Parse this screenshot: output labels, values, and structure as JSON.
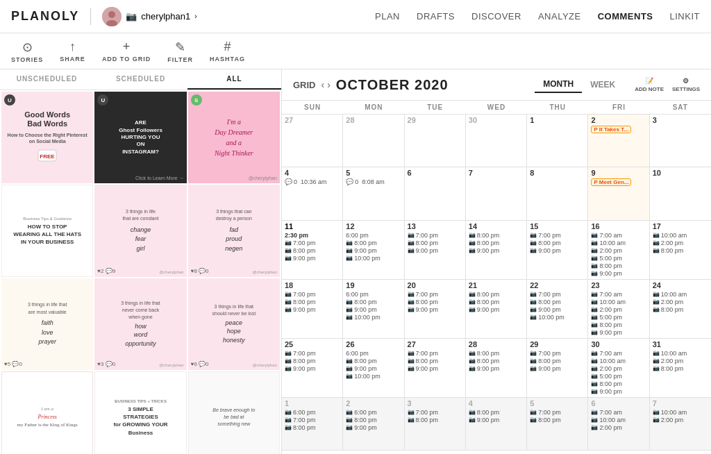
{
  "header": {
    "logo": "PLANOLY",
    "username": "cherylphan1",
    "nav": [
      {
        "label": "PLAN",
        "active": false
      },
      {
        "label": "DRAFTS",
        "active": false
      },
      {
        "label": "DISCOVER",
        "active": false
      },
      {
        "label": "ANALYZE",
        "active": false
      },
      {
        "label": "COMMENTS",
        "active": true
      },
      {
        "label": "LINKIT",
        "active": false
      }
    ]
  },
  "toolbar": [
    {
      "label": "STORIES",
      "icon": "⊙"
    },
    {
      "label": "SHARE",
      "icon": "↑"
    },
    {
      "label": "ADD TO GRID",
      "icon": "+"
    },
    {
      "label": "FILTER",
      "icon": "✎"
    },
    {
      "label": "HASHTAG",
      "icon": "#"
    }
  ],
  "left_panel": {
    "tabs": [
      "UNSCHEDULED",
      "SCHEDULED",
      "ALL"
    ],
    "active_tab": 2
  },
  "calendar": {
    "grid_label": "GRID",
    "month": "OCTOBER 2020",
    "views": [
      "MONTH",
      "WEEK"
    ],
    "active_view": "MONTH",
    "actions": [
      "ADD NOTE",
      "SETTINGS"
    ],
    "day_headers": [
      "SUN",
      "MON",
      "TUE",
      "WED",
      "THU",
      "FRI",
      "SAT"
    ],
    "weeks": [
      {
        "days": [
          {
            "date": "27",
            "current": false,
            "events": []
          },
          {
            "date": "28",
            "current": false,
            "events": []
          },
          {
            "date": "29",
            "current": false,
            "events": []
          },
          {
            "date": "30",
            "current": false,
            "events": []
          },
          {
            "date": "1",
            "current": true,
            "events": []
          },
          {
            "date": "2",
            "current": true,
            "events": [
              {
                "type": "planned",
                "text": "It Takes T..."
              }
            ]
          },
          {
            "date": "3",
            "current": true,
            "events": []
          }
        ]
      },
      {
        "days": [
          {
            "date": "4",
            "current": true,
            "events": [
              {
                "type": "comment",
                "count": "0",
                "time": "10:36 am"
              }
            ]
          },
          {
            "date": "5",
            "current": true,
            "events": [
              {
                "type": "comment",
                "count": "0",
                "time": "8:08 am"
              }
            ]
          },
          {
            "date": "6",
            "current": true,
            "events": []
          },
          {
            "date": "7",
            "current": true,
            "events": []
          },
          {
            "date": "8",
            "current": true,
            "events": []
          },
          {
            "date": "9",
            "current": true,
            "events": [
              {
                "type": "planned",
                "text": "Meet Gen..."
              }
            ]
          },
          {
            "date": "10",
            "current": true,
            "events": []
          }
        ]
      },
      {
        "days": [
          {
            "date": "11",
            "current": true,
            "events": [
              {
                "type": "time",
                "text": "2:30 pm"
              },
              {
                "type": "ig",
                "text": "7:00 pm"
              },
              {
                "type": "ig",
                "text": "8:00 pm"
              },
              {
                "type": "ig",
                "text": "9:00 pm"
              }
            ]
          },
          {
            "date": "12",
            "current": true,
            "events": [
              {
                "type": "time",
                "text": "6:00 pm"
              },
              {
                "type": "ig",
                "text": "8:00 pm"
              },
              {
                "type": "ig",
                "text": "9:00 pm"
              },
              {
                "type": "ig",
                "text": "10:00 pm"
              }
            ]
          },
          {
            "date": "13",
            "current": true,
            "events": [
              {
                "type": "ig",
                "text": "7:00 pm"
              },
              {
                "type": "ig",
                "text": "8:00 pm"
              },
              {
                "type": "ig",
                "text": "9:00 pm"
              }
            ]
          },
          {
            "date": "14",
            "current": true,
            "events": [
              {
                "type": "ig",
                "text": "8:00 pm"
              },
              {
                "type": "ig",
                "text": "8:00 pm"
              },
              {
                "type": "ig",
                "text": "9:00 pm"
              }
            ]
          },
          {
            "date": "15",
            "current": true,
            "events": [
              {
                "type": "ig",
                "text": "7:00 pm"
              },
              {
                "type": "ig",
                "text": "8:00 pm"
              },
              {
                "type": "ig",
                "text": "9:00 pm"
              }
            ]
          },
          {
            "date": "16",
            "current": true,
            "events": [
              {
                "type": "ig",
                "text": "7:00 am"
              },
              {
                "type": "ig",
                "text": "10:00 am"
              },
              {
                "type": "ig",
                "text": "2:00 pm"
              },
              {
                "type": "ig",
                "text": "5:00 pm"
              },
              {
                "type": "ig",
                "text": "8:00 pm"
              },
              {
                "type": "ig",
                "text": "9:00 pm"
              }
            ]
          },
          {
            "date": "17",
            "current": true,
            "events": [
              {
                "type": "ig",
                "text": "10:00 am"
              },
              {
                "type": "ig",
                "text": "2:00 pm"
              },
              {
                "type": "ig",
                "text": "8:00 pm"
              }
            ]
          }
        ]
      },
      {
        "days": [
          {
            "date": "18",
            "current": true,
            "events": [
              {
                "type": "ig",
                "text": "7:00 pm"
              },
              {
                "type": "ig",
                "text": "8:00 pm"
              },
              {
                "type": "ig",
                "text": "9:00 pm"
              }
            ]
          },
          {
            "date": "19",
            "current": true,
            "events": [
              {
                "type": "ig",
                "text": "6:00 pm"
              },
              {
                "type": "ig",
                "text": "8:00 pm"
              },
              {
                "type": "ig",
                "text": "9:00 pm"
              },
              {
                "type": "ig",
                "text": "10:00 pm"
              }
            ]
          },
          {
            "date": "20",
            "current": true,
            "events": [
              {
                "type": "ig",
                "text": "7:00 pm"
              },
              {
                "type": "ig",
                "text": "8:00 pm"
              },
              {
                "type": "ig",
                "text": "9:00 pm"
              }
            ]
          },
          {
            "date": "21",
            "current": true,
            "events": [
              {
                "type": "ig",
                "text": "8:00 pm"
              },
              {
                "type": "ig",
                "text": "8:00 pm"
              },
              {
                "type": "ig",
                "text": "9:00 pm"
              }
            ]
          },
          {
            "date": "22",
            "current": true,
            "events": [
              {
                "type": "ig",
                "text": "7:00 pm"
              },
              {
                "type": "ig",
                "text": "8:00 pm"
              },
              {
                "type": "ig",
                "text": "9:00 pm"
              },
              {
                "type": "ig",
                "text": "10:00 pm"
              }
            ]
          },
          {
            "date": "23",
            "current": true,
            "events": [
              {
                "type": "ig",
                "text": "7:00 am"
              },
              {
                "type": "ig",
                "text": "10:00 am"
              },
              {
                "type": "ig",
                "text": "2:00 pm"
              },
              {
                "type": "ig",
                "text": "5:00 pm"
              },
              {
                "type": "ig",
                "text": "8:00 pm"
              },
              {
                "type": "ig",
                "text": "9:00 pm"
              }
            ]
          },
          {
            "date": "24",
            "current": true,
            "events": [
              {
                "type": "ig",
                "text": "10:00 am"
              },
              {
                "type": "ig",
                "text": "2:00 pm"
              },
              {
                "type": "ig",
                "text": "8:00 pm"
              }
            ]
          }
        ]
      },
      {
        "days": [
          {
            "date": "25",
            "current": true,
            "events": [
              {
                "type": "ig",
                "text": "7:00 pm"
              },
              {
                "type": "ig",
                "text": "8:00 pm"
              },
              {
                "type": "ig",
                "text": "9:00 pm"
              }
            ]
          },
          {
            "date": "26",
            "current": true,
            "events": [
              {
                "type": "ig",
                "text": "6:00 pm"
              },
              {
                "type": "ig",
                "text": "8:00 pm"
              },
              {
                "type": "ig",
                "text": "9:00 pm"
              },
              {
                "type": "ig",
                "text": "10:00 pm"
              }
            ]
          },
          {
            "date": "27",
            "current": true,
            "events": [
              {
                "type": "ig",
                "text": "7:00 pm"
              },
              {
                "type": "ig",
                "text": "8:00 pm"
              },
              {
                "type": "ig",
                "text": "9:00 pm"
              }
            ]
          },
          {
            "date": "28",
            "current": true,
            "events": [
              {
                "type": "ig",
                "text": "8:00 pm"
              },
              {
                "type": "ig",
                "text": "8:00 pm"
              },
              {
                "type": "ig",
                "text": "9:00 pm"
              }
            ]
          },
          {
            "date": "29",
            "current": true,
            "events": [
              {
                "type": "ig",
                "text": "7:00 pm"
              },
              {
                "type": "ig",
                "text": "8:00 pm"
              },
              {
                "type": "ig",
                "text": "9:00 pm"
              }
            ]
          },
          {
            "date": "30",
            "current": true,
            "events": [
              {
                "type": "ig",
                "text": "7:00 am"
              },
              {
                "type": "ig",
                "text": "10:00 am"
              },
              {
                "type": "ig",
                "text": "2:00 pm"
              },
              {
                "type": "ig",
                "text": "5:00 pm"
              },
              {
                "type": "ig",
                "text": "8:00 pm"
              },
              {
                "type": "ig",
                "text": "9:00 pm"
              }
            ]
          },
          {
            "date": "31",
            "current": true,
            "events": [
              {
                "type": "ig",
                "text": "10:00 am"
              },
              {
                "type": "ig",
                "text": "2:00 pm"
              },
              {
                "type": "ig",
                "text": "8:00 pm"
              }
            ]
          }
        ]
      },
      {
        "days": [
          {
            "date": "1",
            "current": false,
            "events": [
              {
                "type": "ig",
                "text": "6:00 pm"
              },
              {
                "type": "ig",
                "text": "7:00 pm"
              },
              {
                "type": "ig",
                "text": "8:00 pm"
              }
            ]
          },
          {
            "date": "2",
            "current": false,
            "events": [
              {
                "type": "ig",
                "text": "6:00 pm"
              },
              {
                "type": "ig",
                "text": "8:00 pm"
              },
              {
                "type": "ig",
                "text": "9:00 pm"
              }
            ]
          },
          {
            "date": "3",
            "current": false,
            "events": [
              {
                "type": "ig",
                "text": "7:00 pm"
              },
              {
                "type": "ig",
                "text": "8:00 pm"
              }
            ]
          },
          {
            "date": "4",
            "current": false,
            "events": [
              {
                "type": "ig",
                "text": "8:00 pm"
              },
              {
                "type": "ig",
                "text": "9:00 pm"
              }
            ]
          },
          {
            "date": "5",
            "current": false,
            "events": [
              {
                "type": "ig",
                "text": "7:00 pm"
              },
              {
                "type": "ig",
                "text": "8:00 pm"
              }
            ]
          },
          {
            "date": "6",
            "current": false,
            "events": [
              {
                "type": "ig",
                "text": "7:00 am"
              },
              {
                "type": "ig",
                "text": "10:00 am"
              },
              {
                "type": "ig",
                "text": "2:00 pm"
              }
            ]
          },
          {
            "date": "7",
            "current": false,
            "events": [
              {
                "type": "ig",
                "text": "10:00 am"
              },
              {
                "type": "ig",
                "text": "2:00 pm"
              }
            ]
          }
        ]
      }
    ]
  },
  "posts": [
    {
      "bg": "pink-light",
      "title": "Good Words Bad Words",
      "subtitle": "How to Choose the Right Pinterest on Social Media",
      "badge": "U",
      "badge_color": "dark"
    },
    {
      "bg": "dark",
      "title": "ARE Ghost Followers HURTING YOU ON INSTAGRAM?",
      "badge": "U",
      "badge_color": "dark"
    },
    {
      "bg": "pink",
      "title": "I'm a Day Dreamer and a Night Thinker",
      "badge": "S",
      "badge_color": "green",
      "handle": "@cherylphan"
    },
    {
      "bg": "white",
      "title": "Business Tips & Guidance\nHOW TO STOP\nWEARING ALL THE HATS\nIN YOUR BUSINESS",
      "badge": "",
      "badge_color": ""
    },
    {
      "bg": "pink-light",
      "title": "3 things in life that are constant\nchange\nfear\ngirl",
      "likes": "2",
      "comments": "9",
      "badge": "",
      "handle": "@cherylphan"
    },
    {
      "bg": "pink-light",
      "title": "3 things that can destroy a person\nfad\nproud\nnegon",
      "likes": "8",
      "comments": "0",
      "badge": "",
      "handle": "@cherylphan"
    },
    {
      "bg": "cream",
      "title": "3 things in life that are most valuable\nfaith\nlove\nprayer",
      "likes": "5",
      "comments": "0"
    },
    {
      "bg": "pink-light",
      "title": "3 things in life that never come back when gone\nhow\nword\nopportunity",
      "likes": "3",
      "comments": "0",
      "handle": "@cherylphan"
    },
    {
      "bg": "pink-light",
      "title": "3 things in life that should never be lost\npeace\nhope\nhonesty",
      "likes": "6",
      "comments": "0",
      "handle": "@cherylphan"
    },
    {
      "bg": "white",
      "title": "Princess\nmy Father is the King of Kings",
      "subtitle": "I am a"
    },
    {
      "bg": "white",
      "title": "BUSINESS TIPS + TRICKS\n3 SIMPLE\nSTRATEGIES\nfor GROWING YOUR\nBusiness",
      "badge": ""
    },
    {
      "bg": "white",
      "title": "Be brave enough to be bad at something new",
      "badge": ""
    }
  ]
}
